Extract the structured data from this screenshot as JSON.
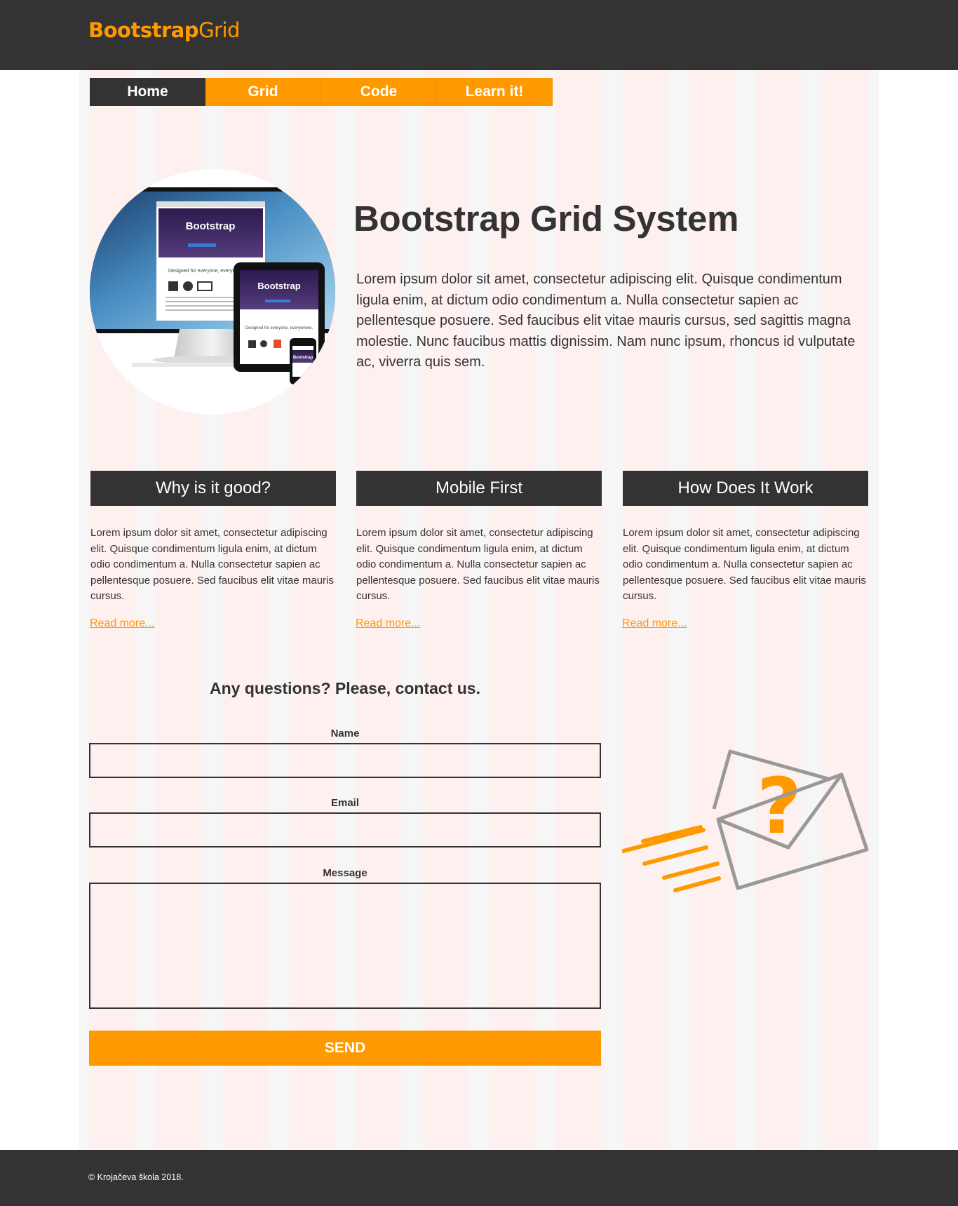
{
  "header": {
    "logo_bold": "Bootstrap",
    "logo_light": "Grid"
  },
  "nav": {
    "items": [
      {
        "label": "Home",
        "active": true
      },
      {
        "label": "Grid"
      },
      {
        "label": "Code"
      },
      {
        "label": "Learn it!"
      }
    ]
  },
  "hero": {
    "title": "Bootstrap Grid System",
    "text": "Lorem ipsum dolor sit amet, consectetur adipiscing elit. Quisque condimentum ligula enim, at dictum odio condimentum a. Nulla consectetur sapien ac pellentesque posuere. Sed faucibus elit vitae mauris cursus, sed sagittis magna molestie. Nunc faucibus mattis dignissim. Nam nunc ipsum, rhoncus id vulputate ac, viverra quis sem.",
    "image": {
      "monitor_title": "Bootstrap",
      "monitor_sub": "Designed for everyone, everywhere.",
      "tablet_title": "Bootstrap",
      "tablet_sub": "Designed for everyone, everywhere.",
      "phone_title": "Bootstrap"
    }
  },
  "features": [
    {
      "heading": "Why is it good?",
      "text": "Lorem ipsum dolor sit amet, consectetur adipiscing elit. Quisque condimentum ligula enim, at dictum odio condimentum a. Nulla consectetur sapien ac pellentesque posuere. Sed faucibus elit vitae mauris cursus.",
      "link": "Read more..."
    },
    {
      "heading": "Mobile First",
      "text": "Lorem ipsum dolor sit amet, consectetur adipiscing elit. Quisque condimentum ligula enim, at dictum odio condimentum a. Nulla consectetur sapien ac pellentesque posuere. Sed faucibus elit vitae mauris cursus.",
      "link": "Read more..."
    },
    {
      "heading": "How Does It Work",
      "text": "Lorem ipsum dolor sit amet, consectetur adipiscing elit. Quisque condimentum ligula enim, at dictum odio condimentum a. Nulla consectetur sapien ac pellentesque posuere. Sed faucibus elit vitae mauris cursus.",
      "link": "Read more..."
    }
  ],
  "contact": {
    "title": "Any questions? Please, contact us.",
    "name_label": "Name",
    "name_value": "",
    "email_label": "Email",
    "email_value": "",
    "message_label": "Message",
    "message_value": "",
    "send_label": "SEND",
    "illustration_icon": "envelope-question-icon"
  },
  "footer": {
    "copyright": "© Krojačeva škola 2018."
  },
  "colors": {
    "accent": "#ff9900",
    "dark": "#333333",
    "grid_col": "#fff0f0",
    "grid_gutter": "#f6f6f6"
  }
}
